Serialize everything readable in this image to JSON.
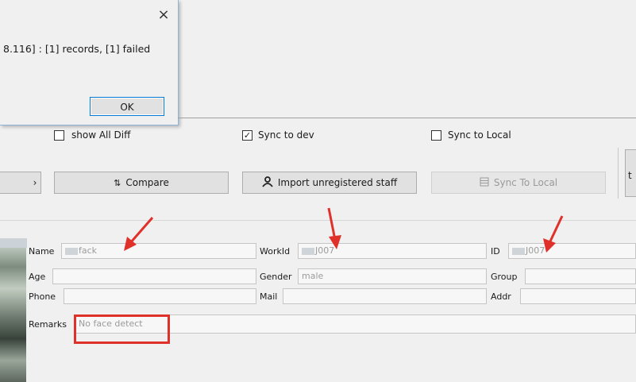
{
  "dialog": {
    "close_glyph": "×",
    "message": "8.116] : [1] records, [1] failed",
    "ok_label": "OK"
  },
  "options": {
    "show_all_diff": {
      "label": "show All Diff",
      "checked": false
    },
    "sync_to_dev": {
      "label": "Sync to dev",
      "checked": true
    },
    "sync_to_local": {
      "label": "Sync to Local",
      "checked": false
    }
  },
  "toolbar": {
    "compare_label": "Compare",
    "import_label": "Import unregistered staff",
    "sync_local_label": "Sync To Local",
    "edge_label": "t"
  },
  "form": {
    "name": {
      "label": "Name",
      "value": "fack"
    },
    "workid": {
      "label": "WorkId",
      "value": "J007"
    },
    "id": {
      "label": "ID",
      "value": "J007"
    },
    "age": {
      "label": "Age",
      "value": ""
    },
    "gender": {
      "label": "Gender",
      "value": "male"
    },
    "group": {
      "label": "Group",
      "value": ""
    },
    "phone": {
      "label": "Phone",
      "value": ""
    },
    "mail": {
      "label": "Mail",
      "value": ""
    },
    "addr": {
      "label": "Addr",
      "value": ""
    },
    "remarks": {
      "label": "Remarks",
      "value": "No face detect"
    }
  },
  "annotation": {
    "color": "#e0302a"
  },
  "icons": {
    "compare": "compare-icon",
    "import": "person-icon",
    "sync_local": "database-icon"
  }
}
